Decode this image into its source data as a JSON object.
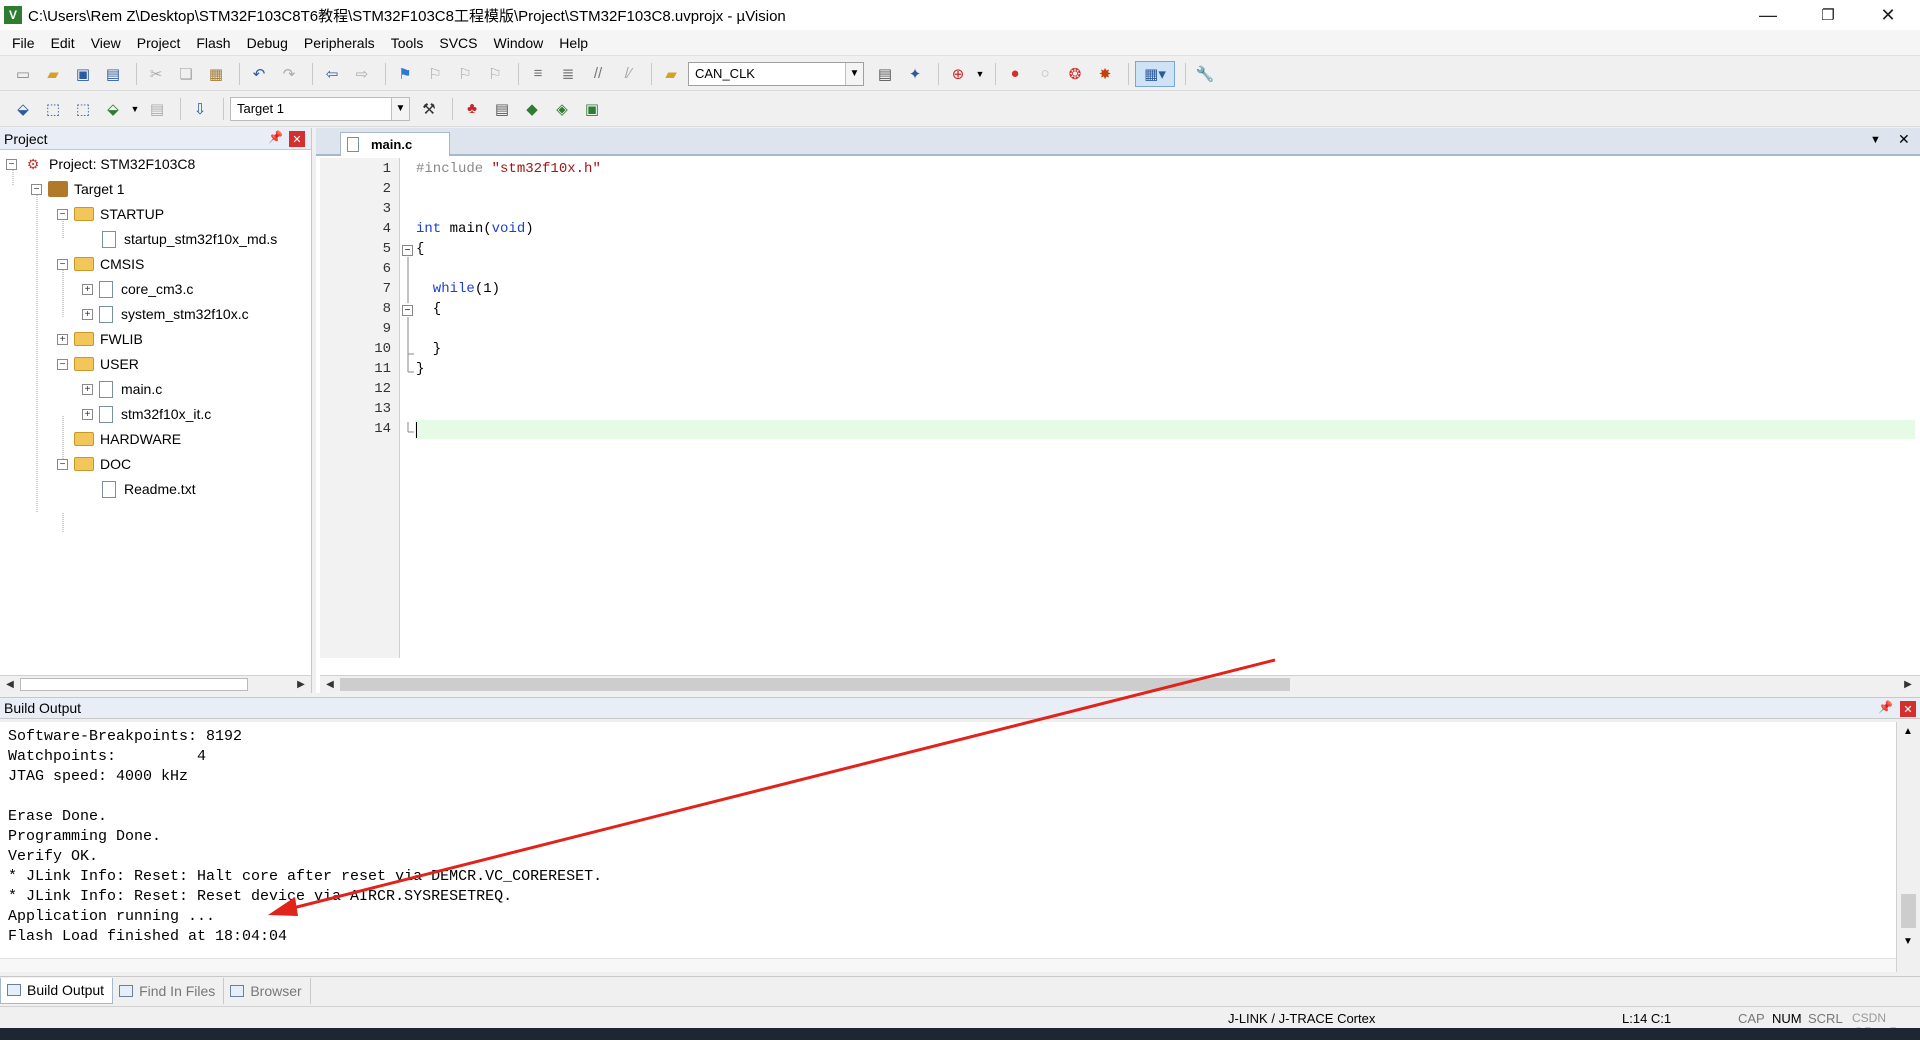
{
  "window": {
    "title": "C:\\Users\\Rem Z\\Desktop\\STM32F103C8T6教程\\STM32F103C8工程模版\\Project\\STM32F103C8.uvprojx - µVision",
    "minimize": "—",
    "restore": "❐",
    "close": "✕"
  },
  "menu": [
    "File",
    "Edit",
    "View",
    "Project",
    "Flash",
    "Debug",
    "Peripherals",
    "Tools",
    "SVCS",
    "Window",
    "Help"
  ],
  "toolbar": {
    "find_combo": "CAN_CLK",
    "target_combo": "Target 1"
  },
  "project_panel": {
    "title": "Project",
    "tree": [
      {
        "label": "Project: STM32F103C8"
      },
      {
        "label": "Target 1"
      },
      {
        "label": "STARTUP"
      },
      {
        "label": "startup_stm32f10x_md.s"
      },
      {
        "label": "CMSIS"
      },
      {
        "label": "core_cm3.c"
      },
      {
        "label": "system_stm32f10x.c"
      },
      {
        "label": "FWLIB"
      },
      {
        "label": "USER"
      },
      {
        "label": "main.c"
      },
      {
        "label": "stm32f10x_it.c"
      },
      {
        "label": "HARDWARE"
      },
      {
        "label": "DOC"
      },
      {
        "label": "Readme.txt"
      }
    ]
  },
  "editor": {
    "tab": "main.c",
    "line_numbers": [
      "1",
      "2",
      "3",
      "4",
      "5",
      "6",
      "7",
      "8",
      "9",
      "10",
      "11",
      "12",
      "13",
      "14"
    ],
    "code": {
      "l1_pp": "#include ",
      "l1_str": "\"stm32f10x.h\"",
      "l4_kw1": "int",
      "l4_mid": " main(",
      "l4_kw2": "void",
      "l4_end": ")",
      "l5": "{",
      "l7_kw": "  while",
      "l7_rest": "(1)",
      "l8": "  {",
      "l10": "  }",
      "l11": "}"
    }
  },
  "build_output": {
    "title": "Build Output",
    "lines": [
      "Software-Breakpoints: 8192",
      "Watchpoints:         4",
      "JTAG speed: 4000 kHz",
      "",
      "Erase Done.",
      "Programming Done.",
      "Verify OK.",
      "* JLink Info: Reset: Halt core after reset via DEMCR.VC_CORERESET.",
      "* JLink Info: Reset: Reset device via AIRCR.SYSRESETREQ.",
      "Application running ...",
      "Flash Load finished at 18:04:04"
    ]
  },
  "bottom_tabs": [
    "Build Output",
    "Find In Files",
    "Browser"
  ],
  "status": {
    "debugger": "J-LINK / J-TRACE Cortex",
    "cursor": "L:14 C:1",
    "cap": "CAP",
    "num": "NUM",
    "scrl": "SCRL",
    "watermark": "CSDN @RemZ"
  },
  "colors": {
    "arrow": "#e0231b",
    "current_line": "#e6fbe6",
    "keyword": "#1f3fd0",
    "string": "#a31515"
  }
}
